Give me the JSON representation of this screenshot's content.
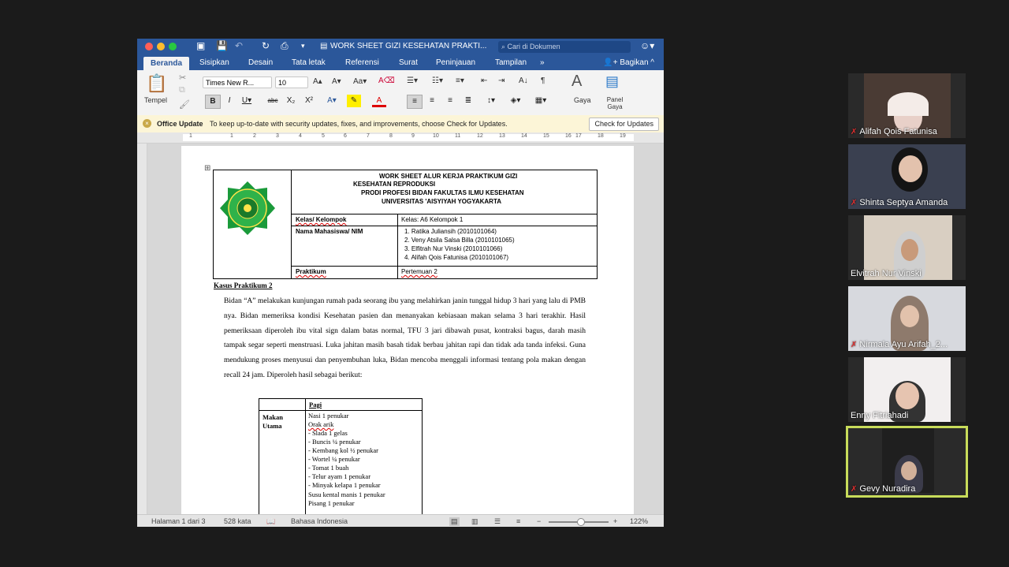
{
  "window": {
    "title": "WORK SHEET GIZI KESEHATAN PRAKTI...",
    "search_placeholder": "Cari di Dokumen"
  },
  "tabs": [
    "Beranda",
    "Sisipkan",
    "Desain",
    "Tata letak",
    "Referensi",
    "Surat",
    "Peninjauan",
    "Tampilan"
  ],
  "share_label": "Bagikan",
  "ribbon": {
    "paste": "Tempel",
    "font_name": "Times New R...",
    "font_size": "10",
    "styles": "Gaya",
    "styles_pane": "Panel Gaya"
  },
  "update_bar": {
    "title": "Office Update",
    "message": "To keep up-to-date with security updates, fixes, and improvements, choose Check for Updates.",
    "button": "Check for Updates"
  },
  "ruler_numbers": [
    "1",
    "1",
    "2",
    "3",
    "4",
    "5",
    "6",
    "7",
    "8",
    "9",
    "10",
    "11",
    "12",
    "13",
    "14",
    "15",
    "16",
    "17",
    "18",
    "19"
  ],
  "document": {
    "header_lines": [
      "WORK SHEET ALUR KERJA PRAKTIKUM GIZI",
      "KESEHATAN REPRODUKSI",
      "PRODI PROFESI BIDAN FAKULTAS ILMU KESEHATAN",
      "UNIVERSITAS 'AISYIYAH YOGYAKARTA"
    ],
    "class_label": "Kelas/ Kelompok",
    "class_value": "Kelas: A6 Kelompok 1",
    "name_label": "Nama Mahasiswa/ NIM",
    "students": [
      "1.    Ratika Juliansih (2010101064)",
      "2.    Veny Atsila Salsa Billa (2010101065)",
      "3.    Elfitrah Nur Vinski (2010101066)",
      "4.    Alifah Qois Fatunisa (2010101067)"
    ],
    "practicum_label": "Praktikum",
    "practicum_value": "Pertemuan 2",
    "case_title": "Kasus Praktikum 2",
    "case_text": "Bidan “A” melakukan kunjungan rumah pada seorang ibu yang melahirkan janin tunggal hidup 3 hari yang lalu di PMB nya. Bidan memeriksa kondisi Kesehatan pasien dan menanyakan kebiasaan makan selama 3 hari terakhir. Hasil pemeriksaan diperoleh ibu vital sign dalam batas normal, TFU 3 jari dibawah pusat, kontraksi bagus, darah masih tampak segar seperti menstruasi. Luka jahitan masih basah tidak berbau jahitan rapi dan tidak ada tanda infeksi. Guna mendukung proses menyusui dan penyembuhan luka, Bidan mencoba menggali informasi tentang pola makan dengan recall 24 jam. Diperoleh hasil sebagai berikut:",
    "meal_header": "Pagi",
    "meal_row_label": "Makan Utama",
    "meal_items": [
      "Nasi 1 penukar",
      "Orak arik",
      "-    Slada 1 gelas",
      "-    Buncis ¼ penukar",
      "-    Kembang kol ½ penukar",
      "-    Wortel ¼ penukar",
      "-    Tomat 1 buah",
      "-    Telur ayam 1 penukar",
      "-    Minyak kelapa 1 penukar",
      "Susu  kental  manis  1  penukar",
      "Pisang 1 penukar"
    ]
  },
  "status": {
    "page": "Halaman 1 dari 3",
    "words": "528 kata",
    "language": "Bahasa Indonesia",
    "zoom": "122%"
  },
  "participants": [
    {
      "name": "Alifah Qois Fatunisa",
      "muted": true
    },
    {
      "name": "Shinta Septya Amanda",
      "muted": true
    },
    {
      "name": "Elvitrah Nur Vinski",
      "muted": false
    },
    {
      "name": "Nirmala Ayu Arifah_2...",
      "muted": true
    },
    {
      "name": "Enny Fitriahadi",
      "muted": false
    },
    {
      "name": "Gevy Nuradira",
      "muted": true
    }
  ]
}
